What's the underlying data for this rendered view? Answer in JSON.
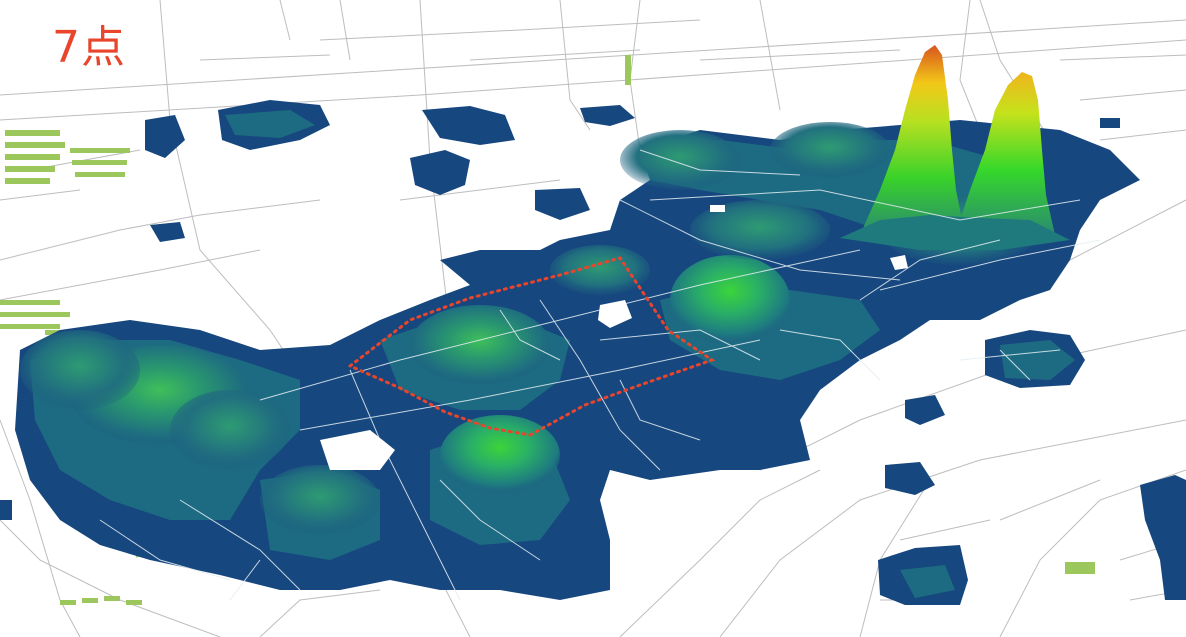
{
  "map": {
    "time_label": "7点",
    "colors": {
      "road": "#bdbdbd",
      "road_on_surface": "#e4eef2",
      "green_parcel": "#9bc75d",
      "density_base": "#17477f",
      "density_mid": "#1e6f83",
      "density_high": "#2aa56b",
      "peak_low": "#39d22a",
      "peak_mid": "#e6e21e",
      "peak_high": "#d8541f",
      "study_boundary": "#e8452c",
      "label": "#e8452c"
    }
  }
}
